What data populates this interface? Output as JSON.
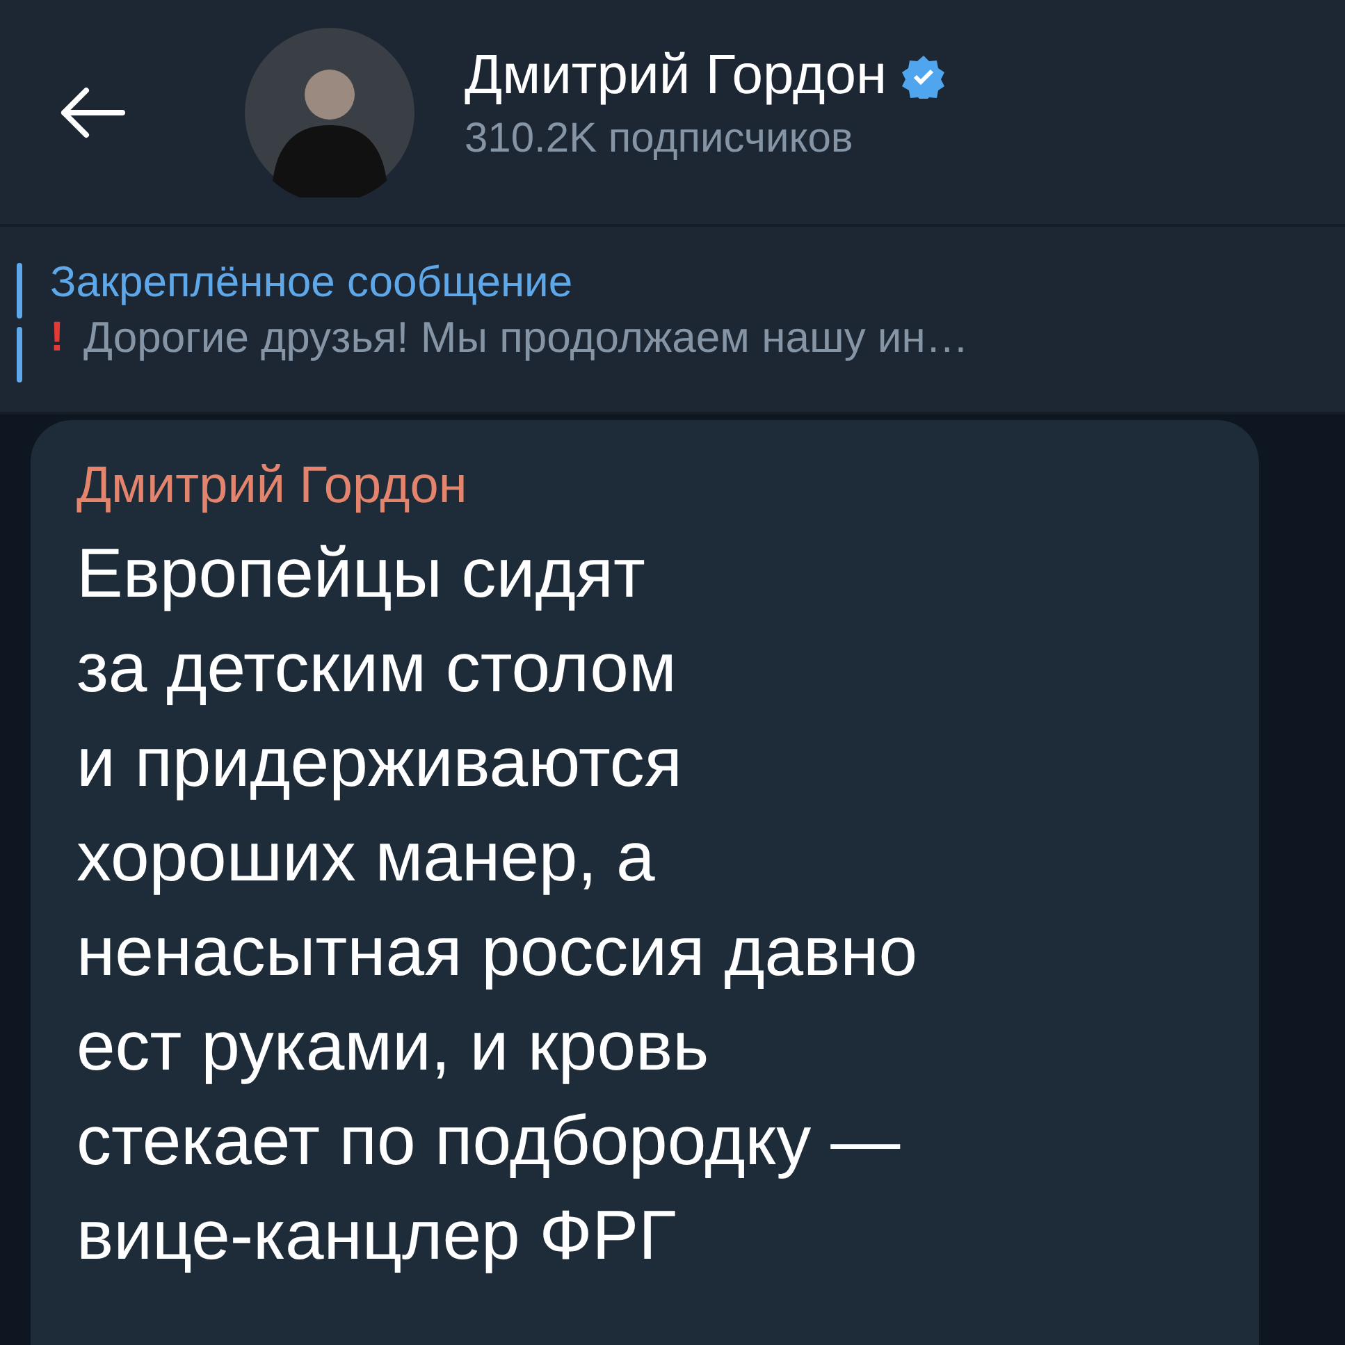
{
  "header": {
    "title": "Дмитрий Гордон",
    "verified": true,
    "subtitle": "310.2K подписчиков"
  },
  "pinned": {
    "label": "Закреплённое сообщение",
    "mark": "!",
    "preview": "Дорогие друзья! Мы продолжаем нашу ин…"
  },
  "message": {
    "sender": "Дмитрий Гордон",
    "text": "Европейцы сидят\nза детским столом\nи придерживаются\nхороших манер, а\nненасытная россия давно\nест руками, и кровь\nстекает по подбородку —\nвице-канцлер ФРГ"
  }
}
